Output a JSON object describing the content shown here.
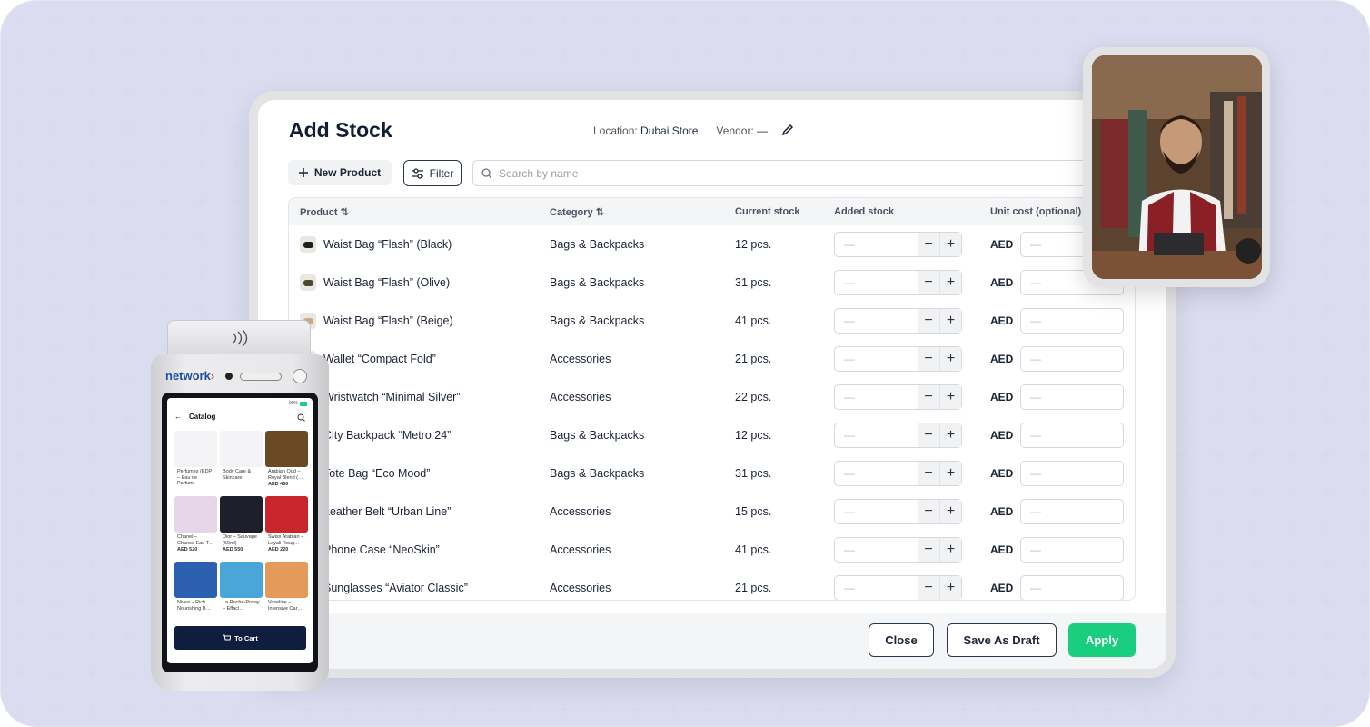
{
  "page": {
    "title": "Add Stock",
    "location_label": "Location:",
    "location_value": "Dubai Store",
    "vendor_label": "Vendor:",
    "vendor_value": "—"
  },
  "toolbar": {
    "new_product_label": "New Product",
    "filter_label": "Filter",
    "search_placeholder": "Search by name"
  },
  "table": {
    "headers": {
      "product": "Product",
      "category": "Category",
      "current_stock": "Current stock",
      "added_stock": "Added stock",
      "unit_cost": "Unit cost (optional)"
    },
    "currency": "AED",
    "empty_value": "—",
    "rows": [
      {
        "product": "Waist Bag “Flash” (Black)",
        "category": "Bags & Backpacks",
        "stock": "12 pcs.",
        "thumb_color": "#1e1e1e"
      },
      {
        "product": "Waist Bag “Flash” (Olive)",
        "category": "Bags & Backpacks",
        "stock": "31 pcs.",
        "thumb_color": "#4a4a2e"
      },
      {
        "product": "Waist Bag “Flash” (Beige)",
        "category": "Bags & Backpacks",
        "stock": "41 pcs.",
        "thumb_color": "#c8a985"
      },
      {
        "product": "Wallet “Compact Fold”",
        "category": "Accessories",
        "stock": "21 pcs.",
        "thumb_color": "#8a5a3a"
      },
      {
        "product": "Wristwatch “Minimal Silver”",
        "category": "Accessories",
        "stock": "22 pcs.",
        "thumb_color": "#b9bcc2"
      },
      {
        "product": "City Backpack “Metro 24”",
        "category": "Bags & Backpacks",
        "stock": "12 pcs.",
        "thumb_color": "#2f3640"
      },
      {
        "product": "Tote Bag “Eco Mood”",
        "category": "Bags & Backpacks",
        "stock": "31 pcs.",
        "thumb_color": "#d9cbb0"
      },
      {
        "product": "Leather Belt “Urban Line”",
        "category": "Accessories",
        "stock": "15 pcs.",
        "thumb_color": "#5a3a24"
      },
      {
        "product": "Phone Case “NeoSkin”",
        "category": "Accessories",
        "stock": "41 pcs.",
        "thumb_color": "#7b8aa0"
      },
      {
        "product": "Sunglasses “Aviator Classic”",
        "category": "Accessories",
        "stock": "21 pcs.",
        "thumb_color": "#3a3a3a"
      }
    ]
  },
  "footer": {
    "close_label": "Close",
    "draft_label": "Save As Draft",
    "apply_label": "Apply"
  },
  "pos": {
    "brand": "network",
    "battery": "90%",
    "screen_title": "Catalog",
    "cart_label": "To Cart",
    "tiles": [
      {
        "title": "Perfumes (EDP – Eau de Parfum)",
        "price": "",
        "color": "#f3f3f5"
      },
      {
        "title": "Body Care & Skincare",
        "price": "",
        "color": "#f3f3f5"
      },
      {
        "title": "Arabian Oud – Royal Blend (…",
        "price": "AED 450",
        "color": "#6a4a22"
      },
      {
        "title": "Chanel – Chance Eau T…",
        "price": "AED 520",
        "color": "#e6d6ea"
      },
      {
        "title": "Dior – Sauvage (60ml)",
        "price": "AED 550",
        "color": "#1d1f2a"
      },
      {
        "title": "Swiss Arabian – Layali Roug…",
        "price": "AED 220",
        "color": "#c8262b"
      },
      {
        "title": "Nivea – Rich Nourishing B…",
        "price": "",
        "color": "#2b5fb0"
      },
      {
        "title": "La Roche-Posay – Effacl…",
        "price": "",
        "color": "#4aa6d8"
      },
      {
        "title": "Vaseline – Intensive Car…",
        "price": "",
        "color": "#e39a5a"
      }
    ]
  },
  "colors": {
    "accent_green": "#19cf7f",
    "navy": "#0f1e3d",
    "text_dark": "#0f1e33"
  }
}
